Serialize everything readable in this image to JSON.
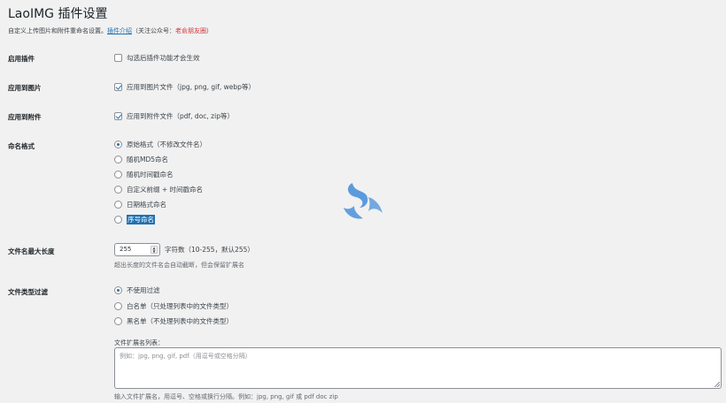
{
  "page": {
    "title": "LaoIMG 插件设置",
    "description_prefix": "自定义上传图片和附件重命名设置。",
    "description_link": "插件介绍",
    "description_middle": "（关注公众号：",
    "description_account": "老俞朋友圈",
    "description_suffix": "）"
  },
  "enable": {
    "label": "启用插件",
    "option": "勾选后插件功能才会生效",
    "checked": false
  },
  "apply_images": {
    "label": "应用到图片",
    "option": "应用到图片文件（jpg, png, gif, webp等）",
    "checked": true
  },
  "apply_attachments": {
    "label": "应用到附件",
    "option": "应用到附件文件（pdf, doc, zip等）",
    "checked": true
  },
  "naming": {
    "label": "命名格式",
    "options": [
      "原始格式（不修改文件名）",
      "随机MD5命名",
      "随机时间戳命名",
      "自定义前缀 + 时间戳命名",
      "日期格式命名",
      "序号命名"
    ],
    "selected_index": 0,
    "highlighted_index": 5
  },
  "max_length": {
    "label": "文件名最大长度",
    "value": "255",
    "suffix": "字符数（10-255，默认255）",
    "hint": "超出长度的文件名会自动截断，但会保留扩展名"
  },
  "type_filter": {
    "label": "文件类型过滤",
    "options": [
      "不使用过滤",
      "白名单（只处理列表中的文件类型）",
      "黑名单（不处理列表中的文件类型）"
    ],
    "selected_index": 0,
    "list_label": "文件扩展名列表：",
    "list_placeholder": "例如：jpg, png, gif, pdf（用逗号或空格分隔）",
    "list_hint": "输入文件扩展名，用逗号、空格或换行分隔。例如：jpg, png, gif 或 pdf doc zip"
  },
  "colors": {
    "accent": "#2271b1",
    "highlight_red": "#d63638",
    "loader_blue": "#4a90d9"
  }
}
